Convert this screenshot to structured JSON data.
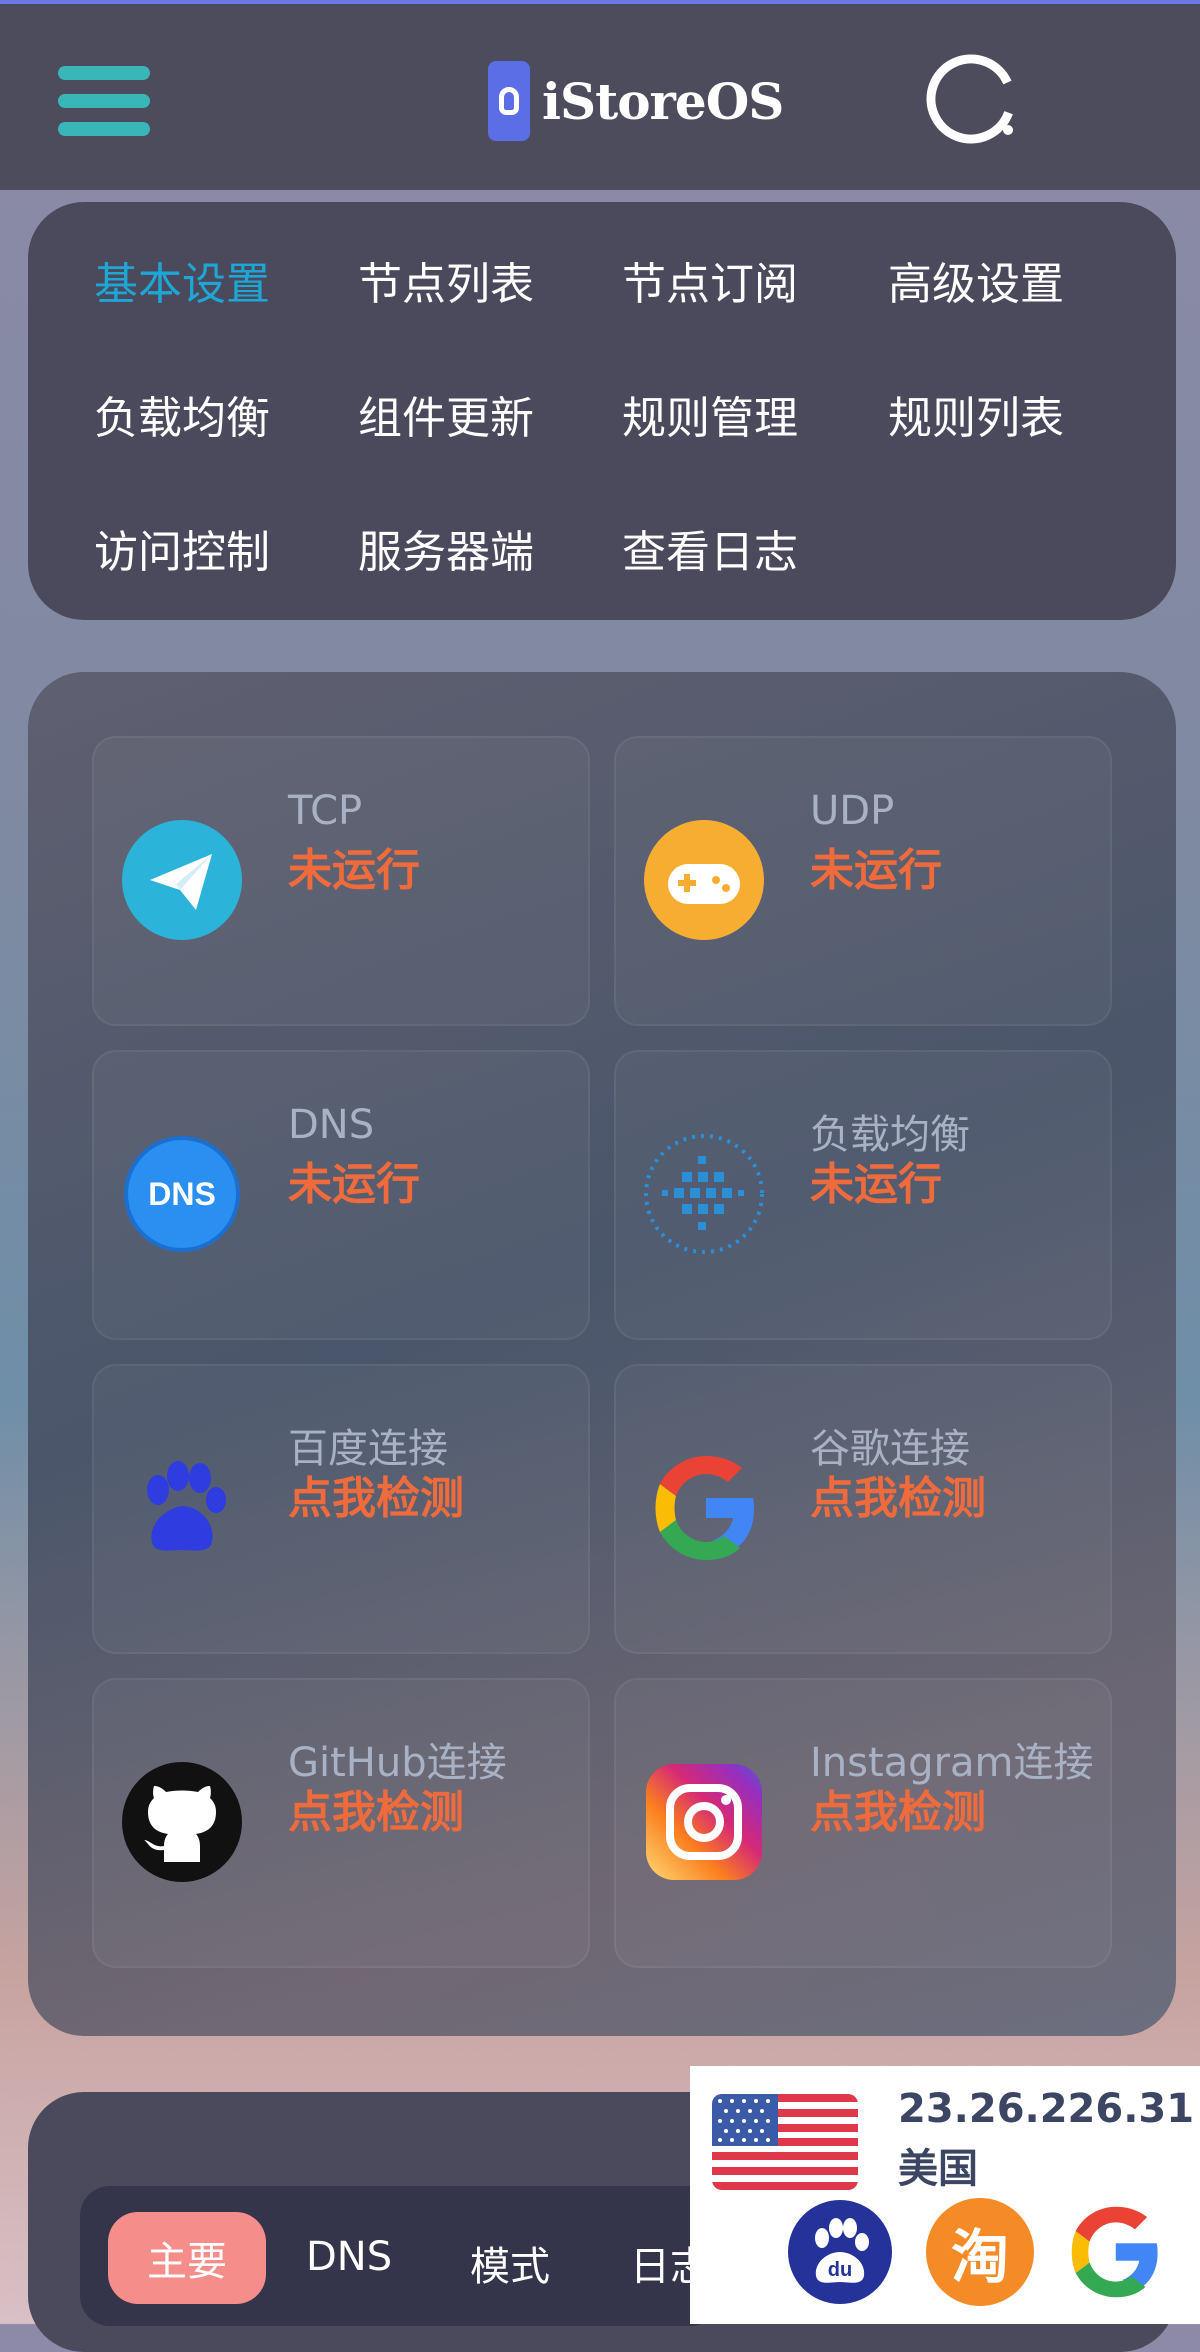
{
  "app": {
    "logo_text": "iStoreOS"
  },
  "nav": {
    "items": [
      {
        "label": "基本设置",
        "active": true
      },
      {
        "label": "节点列表"
      },
      {
        "label": "节点订阅"
      },
      {
        "label": "高级设置"
      },
      {
        "label": "负载均衡"
      },
      {
        "label": "组件更新"
      },
      {
        "label": "规则管理"
      },
      {
        "label": "规则列表"
      },
      {
        "label": "访问控制"
      },
      {
        "label": "服务器端"
      },
      {
        "label": "查看日志"
      }
    ]
  },
  "status_tiles": [
    {
      "title": "TCP",
      "status": "未运行",
      "icon": "paper-plane-icon"
    },
    {
      "title": "UDP",
      "status": "未运行",
      "icon": "gamepad-icon"
    },
    {
      "title": "DNS",
      "status": "未运行",
      "icon": "dns-icon"
    },
    {
      "title": "负载均衡",
      "status": "未运行",
      "icon": "load-balance-icon"
    },
    {
      "title": "百度连接",
      "status": "点我检测",
      "icon": "baidu-paw-icon"
    },
    {
      "title": "谷歌连接",
      "status": "点我检测",
      "icon": "google-icon"
    },
    {
      "title": "GitHub连接",
      "status": "点我检测",
      "icon": "github-icon"
    },
    {
      "title": "Instagram连接",
      "status": "点我检测",
      "icon": "instagram-icon"
    }
  ],
  "bottom_tabs": [
    {
      "label": "主要",
      "active": true
    },
    {
      "label": "DNS"
    },
    {
      "label": "模式"
    },
    {
      "label": "日志"
    }
  ],
  "ip_info": {
    "ip": "23.26.226.31",
    "country": "美国",
    "flag": "us-flag-icon",
    "sites": [
      "baidu-icon",
      "taobao-icon",
      "google-icon"
    ],
    "taobao_glyph": "淘"
  },
  "colors": {
    "accent": "#1ea6d6",
    "status_red": "#f06b3c",
    "header_bg": "#4d4c5d",
    "menu_teal": "#39b6b8",
    "active_tab": "#f58d8a"
  }
}
